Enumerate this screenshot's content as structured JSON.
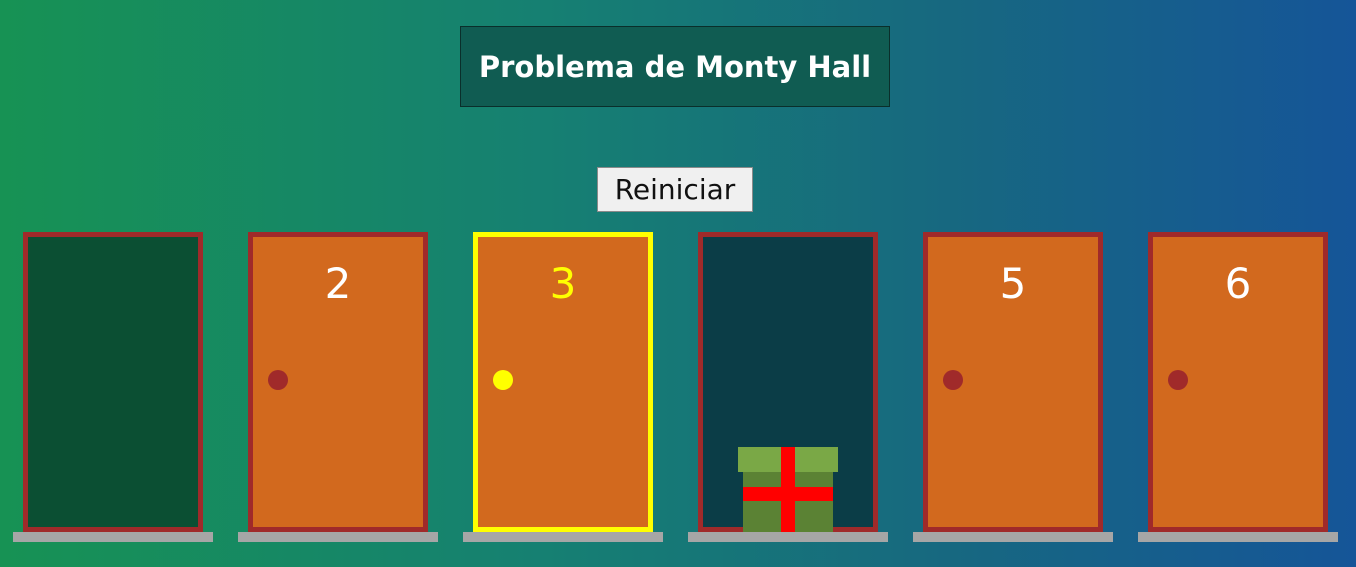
{
  "header": {
    "title": "Problema de Monty Hall"
  },
  "controls": {
    "reset_label": "Reiniciar"
  },
  "doors": [
    {
      "number": "",
      "state": "open-empty",
      "selected": false
    },
    {
      "number": "2",
      "state": "closed",
      "selected": false
    },
    {
      "number": "3",
      "state": "closed",
      "selected": true
    },
    {
      "number": "",
      "state": "open-prize",
      "selected": false
    },
    {
      "number": "5",
      "state": "closed",
      "selected": false
    },
    {
      "number": "6",
      "state": "closed",
      "selected": false
    }
  ],
  "colors": {
    "door": "#d2691e",
    "door_frame": "#a02a2a",
    "selected": "#ffff00",
    "prize_ribbon": "#ff0000"
  },
  "icons": {
    "prize": "gift-icon"
  }
}
